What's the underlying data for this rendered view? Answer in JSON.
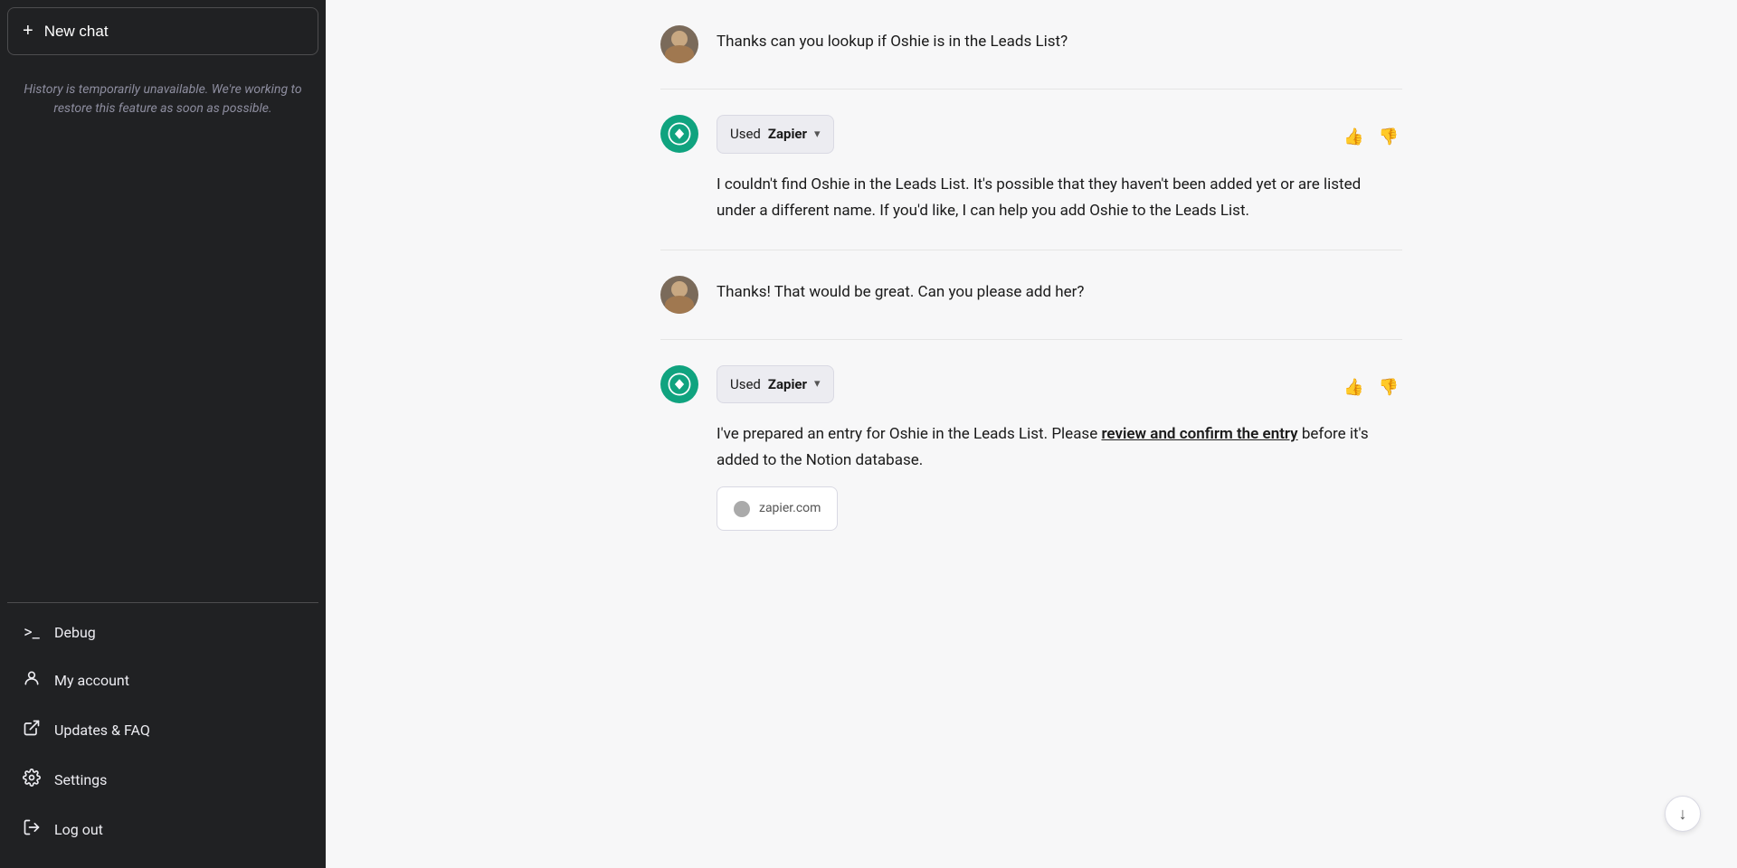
{
  "sidebar": {
    "new_chat_label": "New chat",
    "history_notice": "History is temporarily unavailable. We're working to restore this feature as soon as possible.",
    "nav_items": [
      {
        "id": "debug",
        "label": "Debug",
        "icon": ">_"
      },
      {
        "id": "my-account",
        "label": "My account",
        "icon": "person"
      },
      {
        "id": "updates-faq",
        "label": "Updates & FAQ",
        "icon": "external"
      },
      {
        "id": "settings",
        "label": "Settings",
        "icon": "gear"
      },
      {
        "id": "log-out",
        "label": "Log out",
        "icon": "logout"
      }
    ]
  },
  "chat": {
    "messages": [
      {
        "id": "msg1",
        "role": "user",
        "text": "Thanks can you lookup if Oshie is in the Leads List?"
      },
      {
        "id": "msg2",
        "role": "assistant",
        "tool_label": "Used",
        "tool_name": "Zapier",
        "text": "I couldn't find Oshie in the Leads List. It's possible that they haven't been added yet or are listed under a different name. If you'd like, I can help you add Oshie to the Leads List."
      },
      {
        "id": "msg3",
        "role": "user",
        "text": "Thanks! That would be great. Can you please add her?"
      },
      {
        "id": "msg4",
        "role": "assistant",
        "tool_label": "Used",
        "tool_name": "Zapier",
        "text_before_link": "I've prepared an entry for Oshie in the Leads List. Please ",
        "link_text": "review and confirm the entry",
        "text_after_link": " before it's added to the Notion database.",
        "card_domain": "zapier.com"
      }
    ]
  }
}
